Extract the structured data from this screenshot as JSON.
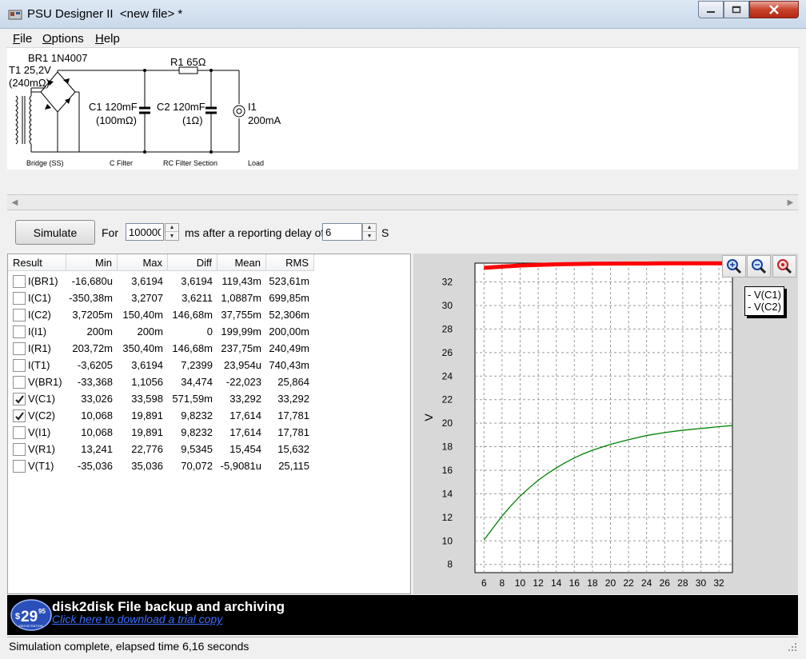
{
  "window": {
    "title": "PSU Designer II  <new file> *"
  },
  "menu": [
    {
      "first": "F",
      "rest": "ile"
    },
    {
      "first": "O",
      "rest": "ptions"
    },
    {
      "first": "H",
      "rest": "elp"
    }
  ],
  "schematic": {
    "bridge_label": "BR1 1N4007",
    "transformer_name": "T1 25,2V",
    "transformer_res": "(240mΩ)",
    "r1_label": "R1 65Ω",
    "c1_name": "C1 120mF",
    "c1_res": "(100mΩ)",
    "c2_name": "C2 120mF",
    "c2_res": "(1Ω)",
    "load_name": "I1",
    "load_value": "200mA",
    "section_bridge": "Bridge (SS)",
    "section_cfilter": "C Filter",
    "section_rc": "RC Filter Section",
    "section_load": "Load"
  },
  "controls": {
    "simulate_label": "Simulate",
    "for_label": "For",
    "duration_value": "100000",
    "ms_label": "ms  after a reporting delay of",
    "delay_value": "6",
    "s_label": "S"
  },
  "results": {
    "columns": [
      "Result",
      "Min",
      "Max",
      "Diff",
      "Mean",
      "RMS"
    ],
    "rows": [
      {
        "name": "I(BR1)",
        "checked": false,
        "min": "-16,680u",
        "max": "3,6194",
        "diff": "3,6194",
        "mean": "119,43m",
        "rms": "523,61m"
      },
      {
        "name": "I(C1)",
        "checked": false,
        "min": "-350,38m",
        "max": "3,2707",
        "diff": "3,6211",
        "mean": "1,0887m",
        "rms": "699,85m"
      },
      {
        "name": "I(C2)",
        "checked": false,
        "min": "3,7205m",
        "max": "150,40m",
        "diff": "146,68m",
        "mean": "37,755m",
        "rms": "52,306m"
      },
      {
        "name": "I(I1)",
        "checked": false,
        "min": "200m",
        "max": "200m",
        "diff": "0",
        "mean": "199,99m",
        "rms": "200,00m"
      },
      {
        "name": "I(R1)",
        "checked": false,
        "min": "203,72m",
        "max": "350,40m",
        "diff": "146,68m",
        "mean": "237,75m",
        "rms": "240,49m"
      },
      {
        "name": "I(T1)",
        "checked": false,
        "min": "-3,6205",
        "max": "3,6194",
        "diff": "7,2399",
        "mean": "23,954u",
        "rms": "740,43m"
      },
      {
        "name": "V(BR1)",
        "checked": false,
        "min": "-33,368",
        "max": "1,1056",
        "diff": "34,474",
        "mean": "-22,023",
        "rms": "25,864"
      },
      {
        "name": "V(C1)",
        "checked": true,
        "min": "33,026",
        "max": "33,598",
        "diff": "571,59m",
        "mean": "33,292",
        "rms": "33,292"
      },
      {
        "name": "V(C2)",
        "checked": true,
        "min": "10,068",
        "max": "19,891",
        "diff": "9,8232",
        "mean": "17,614",
        "rms": "17,781"
      },
      {
        "name": "V(I1)",
        "checked": false,
        "min": "10,068",
        "max": "19,891",
        "diff": "9,8232",
        "mean": "17,614",
        "rms": "17,781"
      },
      {
        "name": "V(R1)",
        "checked": false,
        "min": "13,241",
        "max": "22,776",
        "diff": "9,5345",
        "mean": "15,454",
        "rms": "15,632"
      },
      {
        "name": "V(T1)",
        "checked": false,
        "min": "-35,036",
        "max": "35,036",
        "diff": "70,072",
        "mean": "-5,9081u",
        "rms": "25,115"
      }
    ]
  },
  "chart_data": {
    "type": "line",
    "ylabel": "V",
    "xlim": [
      5,
      33.5
    ],
    "ylim": [
      7.3,
      33.6
    ],
    "x_ticks": [
      6,
      8,
      10,
      12,
      14,
      16,
      18,
      20,
      22,
      24,
      26,
      28,
      30,
      32
    ],
    "y_ticks": [
      8,
      10,
      12,
      14,
      16,
      18,
      20,
      22,
      24,
      26,
      28,
      30,
      32
    ],
    "grid": true,
    "legend_position": "top-right",
    "series": [
      {
        "name": "V(C1)",
        "color": "#ff0000",
        "x": [
          6,
          8,
          10,
          12,
          14,
          16,
          18,
          20,
          22,
          24,
          26,
          28,
          30,
          32,
          33.5
        ],
        "y": [
          33.2,
          33.3,
          33.4,
          33.45,
          33.5,
          33.52,
          33.55,
          33.56,
          33.57,
          33.57,
          33.58,
          33.58,
          33.58,
          33.58,
          33.58
        ]
      },
      {
        "name": "V(C2)",
        "color": "#008000",
        "x": [
          6,
          7,
          8,
          9,
          10,
          11,
          12,
          13,
          14,
          15,
          16,
          17,
          18,
          19,
          20,
          22,
          24,
          26,
          28,
          30,
          32,
          33.5
        ],
        "y": [
          10.07,
          11.1,
          12.1,
          13.0,
          13.8,
          14.5,
          15.15,
          15.7,
          16.2,
          16.65,
          17.05,
          17.4,
          17.7,
          17.95,
          18.2,
          18.6,
          18.95,
          19.2,
          19.4,
          19.55,
          19.7,
          19.8
        ]
      }
    ]
  },
  "icons": {
    "zoom_in": "zoom-in-icon",
    "zoom_out": "zoom-out-icon",
    "zoom_fit": "zoom-fit-icon"
  },
  "banner": {
    "price_main": "29",
    "price_cents": "95",
    "price_sub": "REGISTRATION",
    "title": "disk2disk File backup and archiving",
    "link": "Click here to download a trial copy"
  },
  "status": {
    "text": "Simulation complete, elapsed time 6,16 seconds"
  }
}
